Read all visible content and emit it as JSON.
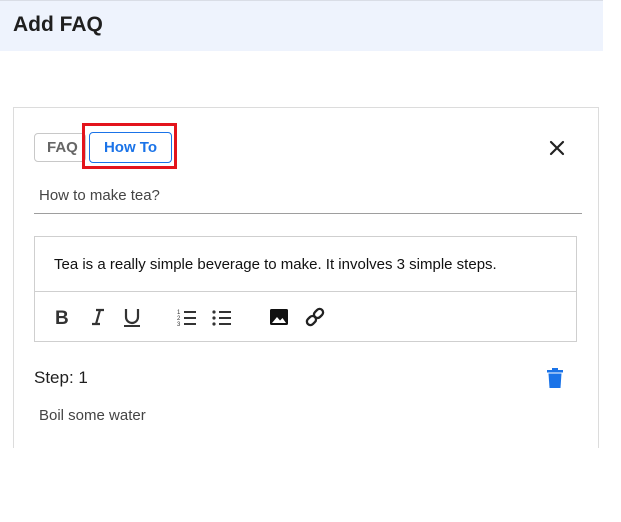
{
  "header": {
    "title": "Add FAQ"
  },
  "tabs": [
    {
      "label": "FAQ",
      "selected": false
    },
    {
      "label": "How To",
      "selected": true
    }
  ],
  "question": {
    "value": "How to make tea?"
  },
  "editor": {
    "content": "Tea is a really simple beverage to make. It involves 3 simple steps.",
    "toolbar": [
      "bold-icon",
      "italic-icon",
      "underline-icon",
      "ordered-list-icon",
      "bullet-list-icon",
      "image-icon",
      "link-icon"
    ]
  },
  "steps": [
    {
      "label": "Step: 1",
      "value": "Boil some water"
    }
  ],
  "colors": {
    "accent": "#1a73e8",
    "highlight": "#e3141c",
    "header_bg": "#eef3fd"
  }
}
